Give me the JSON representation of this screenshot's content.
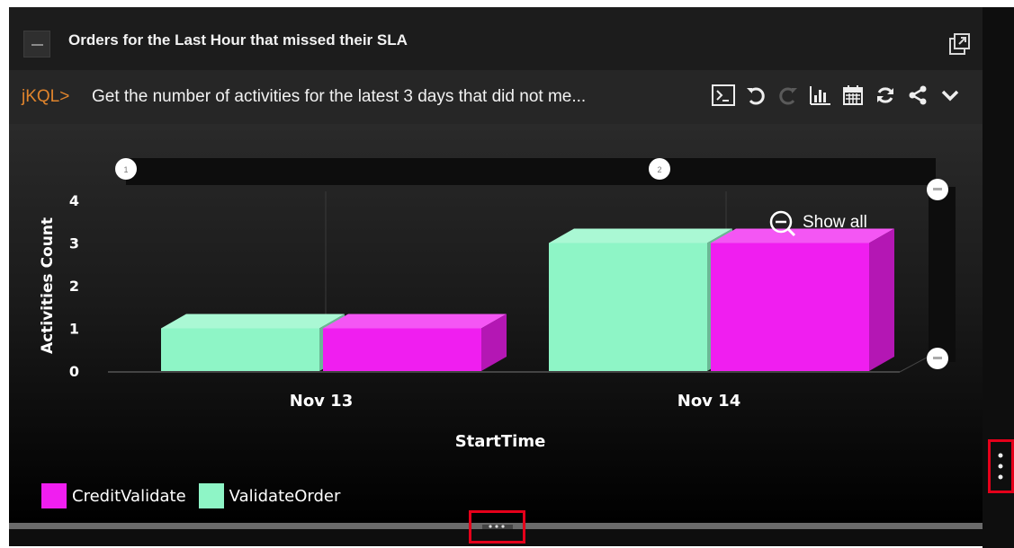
{
  "panel": {
    "title": "Orders for the Last Hour that missed their SLA"
  },
  "query": {
    "prompt": "jKQL>",
    "text": "Get the number of activities for the latest 3 days that did not me..."
  },
  "toolbar": {
    "icons": [
      "terminal-icon",
      "undo-icon",
      "redo-icon",
      "chart-icon",
      "calendar-icon",
      "refresh-icon",
      "share-icon",
      "chevron-down-icon"
    ]
  },
  "chart_data": {
    "type": "bar",
    "categories": [
      "Nov 13",
      "Nov 14"
    ],
    "series": [
      {
        "name": "ValidateOrder",
        "values": [
          1,
          3
        ],
        "color": "#8ef5c6"
      },
      {
        "name": "CreditValidate",
        "values": [
          1,
          3
        ],
        "color": "#f01ef0"
      }
    ],
    "xlabel": "StartTime",
    "ylabel": "Activities Count",
    "ylim": [
      0,
      4
    ],
    "yticks": [
      "0",
      "1",
      "2",
      "3",
      "4"
    ],
    "zoom_label": "Show all",
    "scroll_markers": [
      "1",
      "2"
    ],
    "legend_placement": "bottom-left"
  },
  "legend": {
    "items": [
      {
        "label": "CreditValidate",
        "color": "#f01ef0"
      },
      {
        "label": "ValidateOrder",
        "color": "#8ef5c6"
      }
    ]
  },
  "colors": {
    "accent_prompt": "#e0842c",
    "highlight": "#e5001a"
  }
}
